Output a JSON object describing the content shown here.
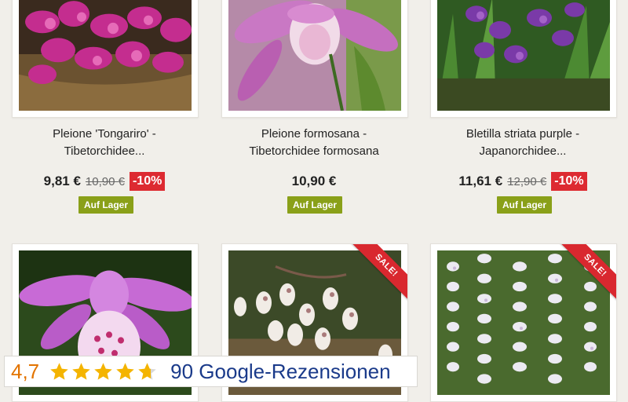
{
  "products": [
    {
      "title_line1": "Pleione 'Tongariro' -",
      "title_line2": "Tibetorchidee...",
      "price": "9,81 €",
      "old_price": "10,90 €",
      "discount": "-10%",
      "stock": "Auf Lager",
      "image": "pink-pleione-basket"
    },
    {
      "title_line1": "Pleione formosana -",
      "title_line2": "Tibetorchidee formosana",
      "price": "10,90 €",
      "stock": "Auf Lager",
      "image": "pale-pink-pleione"
    },
    {
      "title_line1": "Bletilla striata purple -",
      "title_line2": "Japanorchidee...",
      "price": "11,61 €",
      "old_price": "12,90 €",
      "discount": "-10%",
      "stock": "Auf Lager",
      "image": "purple-bletilla"
    },
    {
      "image": "pink-orchid-closeup"
    },
    {
      "sale_badge": "SALE!",
      "image": "white-cluster-orchid"
    },
    {
      "sale_badge": "SALE!",
      "image": "white-spike-orchid"
    }
  ],
  "rating_widget": {
    "score": "4,7",
    "stars_value": 4.7,
    "stars_max": 5,
    "reviews_label": "90 Google-Rezensionen",
    "star_icon": "star-icon",
    "colors": {
      "score": "#e37400",
      "stars": "#f4b400",
      "reviews": "#1a3a8a"
    }
  },
  "colors": {
    "discount": "#dd2a31",
    "stock_badge": "#8aa019",
    "sale_ribbon": "#d9282f"
  }
}
